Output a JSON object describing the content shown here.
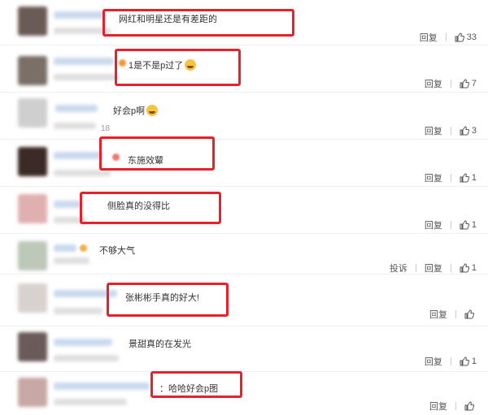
{
  "comments": [
    {
      "text": "网红和明星还是有差距的",
      "emoji": false,
      "reply": "回复",
      "likes": "33",
      "report": ""
    },
    {
      "text": "1是不是p过了",
      "emoji": true,
      "reply": "回复",
      "likes": "7",
      "report": ""
    },
    {
      "text": "好会p啊",
      "emoji": true,
      "reply": "回复",
      "likes": "3",
      "report": "",
      "extra": "18"
    },
    {
      "text": "东施效颦",
      "emoji": false,
      "reply": "回复",
      "likes": "1",
      "report": ""
    },
    {
      "text": "侧脸真的没得比",
      "emoji": false,
      "reply": "回复",
      "likes": "1",
      "report": ""
    },
    {
      "text": "不够大气",
      "emoji": false,
      "reply": "回复",
      "likes": "1",
      "report": "投诉"
    },
    {
      "text": "张彬彬手真的好大!",
      "emoji": false,
      "reply": "回复",
      "likes": "",
      "report": ""
    },
    {
      "text": "景甜真的在发光",
      "emoji": false,
      "reply": "回复",
      "likes": "1",
      "report": ""
    },
    {
      "text": "哈哈好会p图",
      "emoji": false,
      "reply": "回复",
      "likes": "",
      "report": ""
    }
  ],
  "colors": {
    "highlight": "#e8202a",
    "username": "#c9d9ee"
  },
  "icons": {
    "like": "thumbs-up-icon"
  }
}
